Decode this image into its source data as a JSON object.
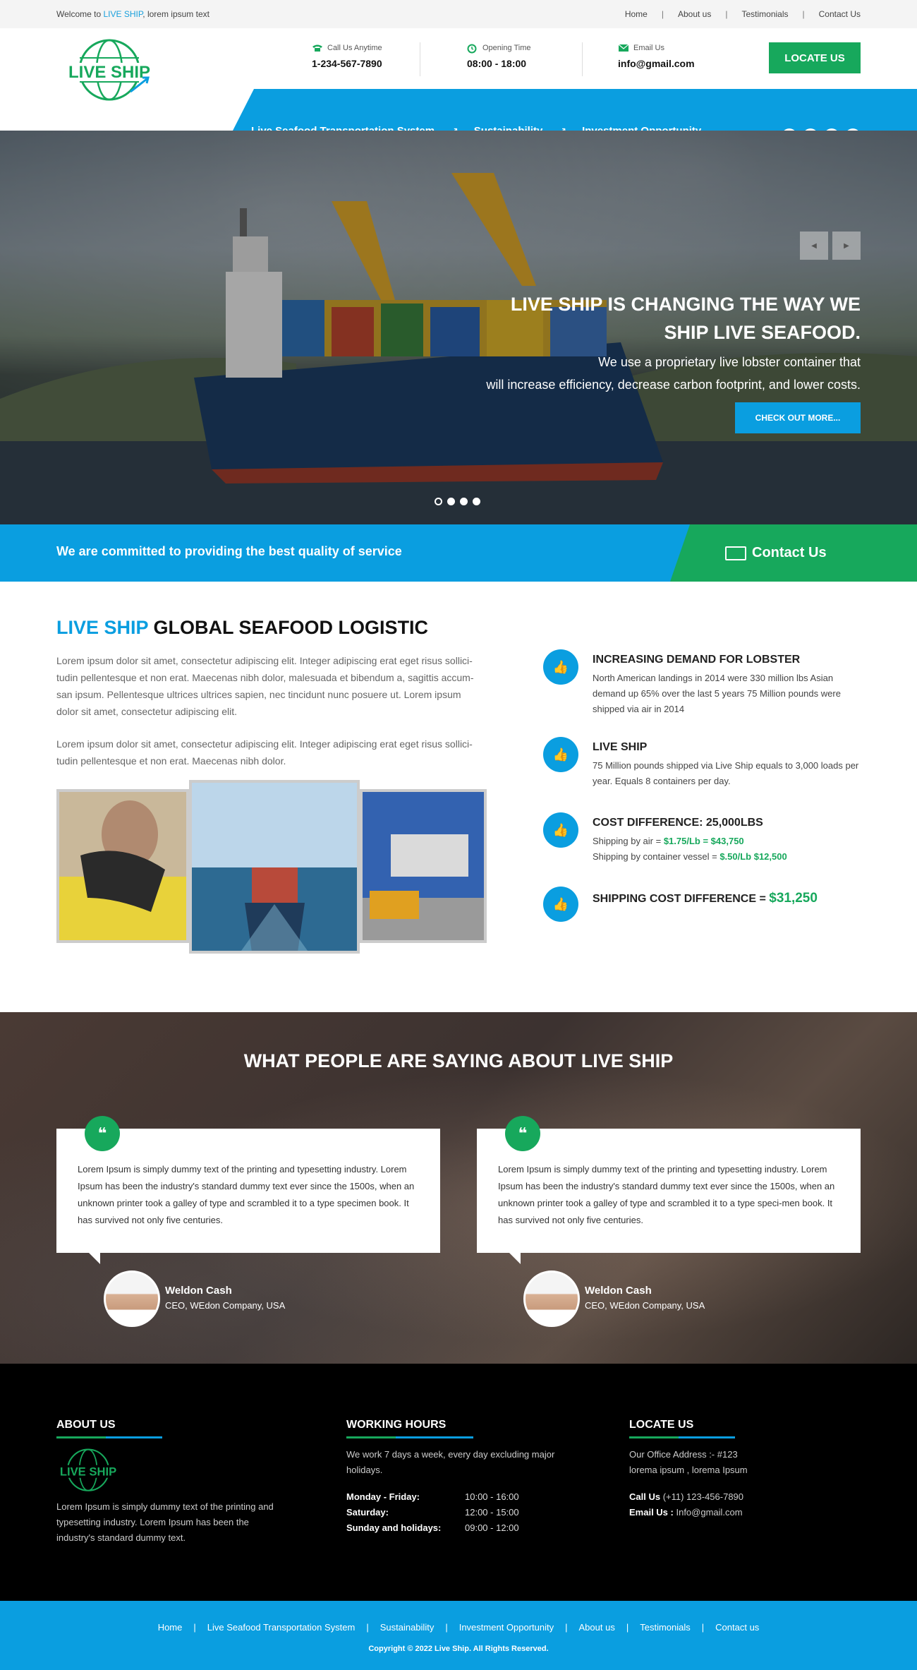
{
  "topbar": {
    "welcome_prefix": "Welcome to ",
    "welcome_brand": "LIVE SHIP",
    "welcome_suffix": ", lorem ipsum text",
    "nav": [
      "Home",
      "About us",
      "Testimonials",
      "Contact Us"
    ]
  },
  "header": {
    "logo_text": "LIVE SHIP",
    "call_label": "Call Us Anytime",
    "call_value": "1-234-567-7890",
    "hours_label": "Opening Time",
    "hours_value": "08:00 - 18:00",
    "email_label": "Email Us",
    "email_value": "info@gmail.com",
    "locate_button": "LOCATE US"
  },
  "mainnav": [
    "Live Seafood Transportation System",
    "Sustainability",
    "Investment Opportunity"
  ],
  "social": [
    "f",
    "in",
    "t",
    "ig"
  ],
  "hero": {
    "title_line1": "LIVE SHIP IS CHANGING THE WAY WE",
    "title_line2": "SHIP LIVE SEAFOOD.",
    "sub_line1": "We use a  proprietary live lobster container that",
    "sub_line2": "will increase efficiency, decrease carbon footprint, and lower costs.",
    "button": "CHECK OUT MORE...",
    "prev": "◀",
    "next": "▶"
  },
  "band": {
    "text": "We are committed to providing the best quality of service",
    "contact": "Contact Us"
  },
  "about": {
    "title_brand": "LIVE SHIP",
    "title_rest": " GLOBAL SEAFOOD LOGISTIC",
    "para1": "Lorem ipsum dolor sit amet, consectetur adipiscing elit. Integer adipiscing erat eget risus sollici-tudin pellentesque et non erat. Maecenas nibh dolor, malesuada et bibendum a, sagittis accum-san ipsum. Pellentesque ultrices ultrices sapien, nec tincidunt nunc posuere ut. Lorem ipsum dolor sit amet, consectetur adipiscing elit.",
    "para2": "Lorem ipsum dolor sit amet, consectetur adipiscing elit. Integer adipiscing erat eget risus sollici-tudin pellentesque et non erat. Maecenas nibh dolor.",
    "features": [
      {
        "title": "INCREASING DEMAND FOR LOBSTER",
        "desc": "North American landings in 2014 were 330 million lbs Asian demand up 65% over the last 5 years 75 Million pounds were shipped via air in 2014"
      },
      {
        "title": "LIVE SHIP",
        "desc": "75 Million pounds shipped via Live Ship equals to 3,000 loads per year.  Equals 8 containers per day."
      },
      {
        "title": "COST DIFFERENCE: 25,000LBS",
        "air_label": "Shipping by air = ",
        "air_value": "$1.75/Lb = $43,750",
        "vessel_label": "Shipping by container vessel = ",
        "vessel_value": "$.50/Lb $12,500"
      },
      {
        "title": "SHIPPING COST DIFFERENCE = ",
        "value": "$31,250"
      }
    ]
  },
  "testimonials": {
    "heading": "WHAT PEOPLE ARE SAYING ABOUT LIVE SHIP",
    "items": [
      {
        "text": "Lorem Ipsum is simply dummy text of the printing and typesetting industry. Lorem Ipsum has been the industry's standard dummy text ever since the 1500s, when an unknown printer took a galley of type and scrambled it to  a type specimen book. It has survived not only five centuries.",
        "name": "Weldon Cash",
        "role": "CEO, WEdon Company, USA"
      },
      {
        "text": "Lorem Ipsum is simply dummy text of the printing and typesetting industry. Lorem Ipsum has been the industry's standard dummy text ever since the 1500s, when an unknown printer took a galley of type and scrambled it to  a type speci-men book. It has survived not only five centuries.",
        "name": "Weldon Cash",
        "role": "CEO, WEdon Company, USA"
      }
    ]
  },
  "footer": {
    "about_title": "ABOUT US",
    "about_logo": "LIVE SHIP",
    "about_text": "Lorem Ipsum is simply dummy text of the printing and typesetting industry. Lorem Ipsum has been the industry's standard dummy text.",
    "hours_title": "WORKING HOURS",
    "hours_intro": "We work 7 days a week, every day excluding major holidays.",
    "hours": [
      {
        "day": "Monday - Friday:",
        "time": "10:00 - 16:00"
      },
      {
        "day": "Saturday:",
        "time": "12:00 - 15:00"
      },
      {
        "day": "Sunday and holidays:",
        "time": "09:00 - 12:00"
      }
    ],
    "locate_title": "LOCATE US",
    "address_line1": "Our Office Address :- #123",
    "address_line2": "lorema ipsum  , lorema Ipsum",
    "call_label": "Call Us",
    "call_value": " (+11) 123-456-7890",
    "email_label": "Email Us :",
    "email_value": " Info@gmail.com"
  },
  "bottom": {
    "nav": [
      "Home",
      "Live Seafood Transportation System",
      "Sustainability",
      "Investment Opportunity",
      "About us",
      "Testimonials",
      "Contact us"
    ],
    "copyright": "Copyright © 2022 Live Ship. All Rights Reserved."
  },
  "colors": {
    "blue": "#0a9ee0",
    "green": "#17a85c",
    "footer_bg": "#000000"
  }
}
